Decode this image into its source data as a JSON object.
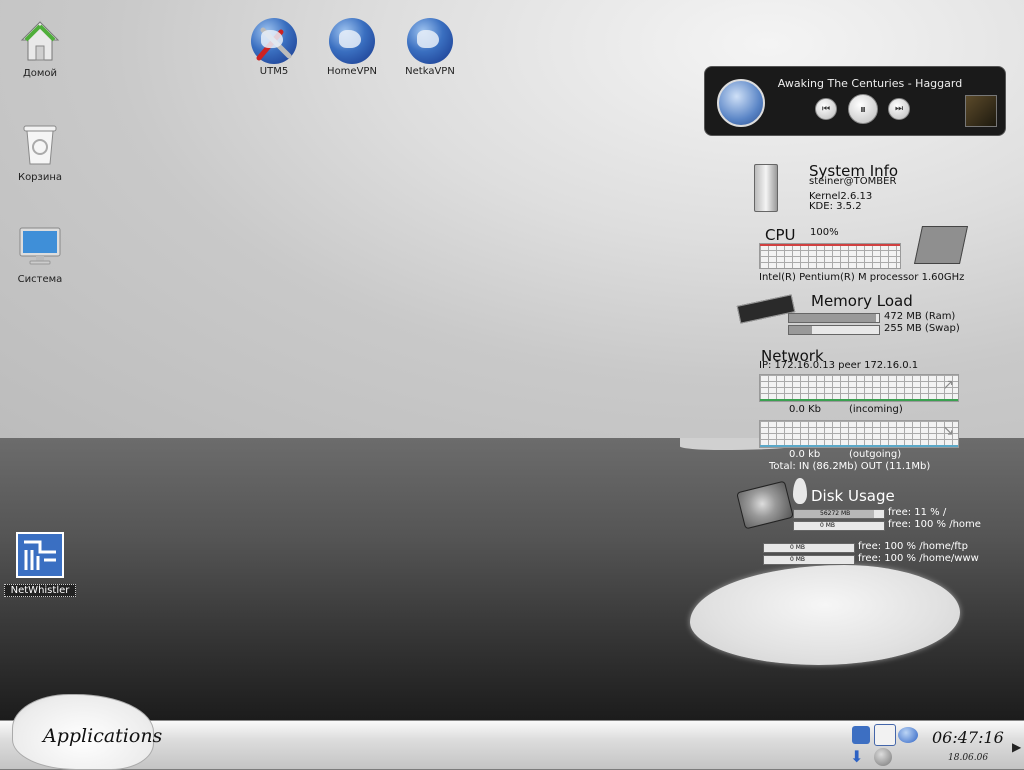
{
  "desktop_icons": [
    {
      "label": "Домой"
    },
    {
      "label": "Корзина"
    },
    {
      "label": "Система"
    },
    {
      "label": "UTM5"
    },
    {
      "label": "HomeVPN"
    },
    {
      "label": "NetkaVPN"
    },
    {
      "label": "NetWhistler"
    }
  ],
  "player": {
    "track": "Awaking The Centuries - Haggard"
  },
  "sysinfo": {
    "title": "System Info",
    "user": "steiner@TOMBER",
    "kernel": "Kernel2.6.13",
    "kde": "KDE: 3.5.2",
    "cpu_title": "CPU",
    "cpu_percent": "100%",
    "cpu_name": "Intel(R) Pentium(R) M processor 1.60GHz",
    "mem_title": "Memory Load",
    "ram_label": "472 MB (Ram)",
    "swap_label": "255 MB (Swap)",
    "ram_fill": 0.97,
    "swap_fill": 0.25,
    "net_title": "Network",
    "ip_line": "IP:  172.16.0.13 peer 172.16.0.1",
    "incoming_value": "0.0 Kb",
    "incoming_label": "(incoming)",
    "outgoing_value": "0.0 kb",
    "outgoing_label": "(outgoing)",
    "total_line": "Total: IN (86.2Mb)  OUT (11.1Mb)",
    "disk_title": "Disk Usage",
    "disks": [
      {
        "size": "56272 MB",
        "free": "free: 11 % /"
      },
      {
        "size": "0 MB",
        "free": "free: 100 % /home"
      },
      {
        "size": "0 MB",
        "free": "free: 100 % /home/ftp"
      },
      {
        "size": "0 MB",
        "free": "free: 100 % /home/www"
      }
    ]
  },
  "taskbar": {
    "applications_label": "Applications",
    "time": "06:47:16",
    "date": "18.06.06"
  },
  "colors": {
    "cpu_line": "#d04040",
    "net_in_line": "#3aa050",
    "net_out_line": "#5aa8c8"
  }
}
